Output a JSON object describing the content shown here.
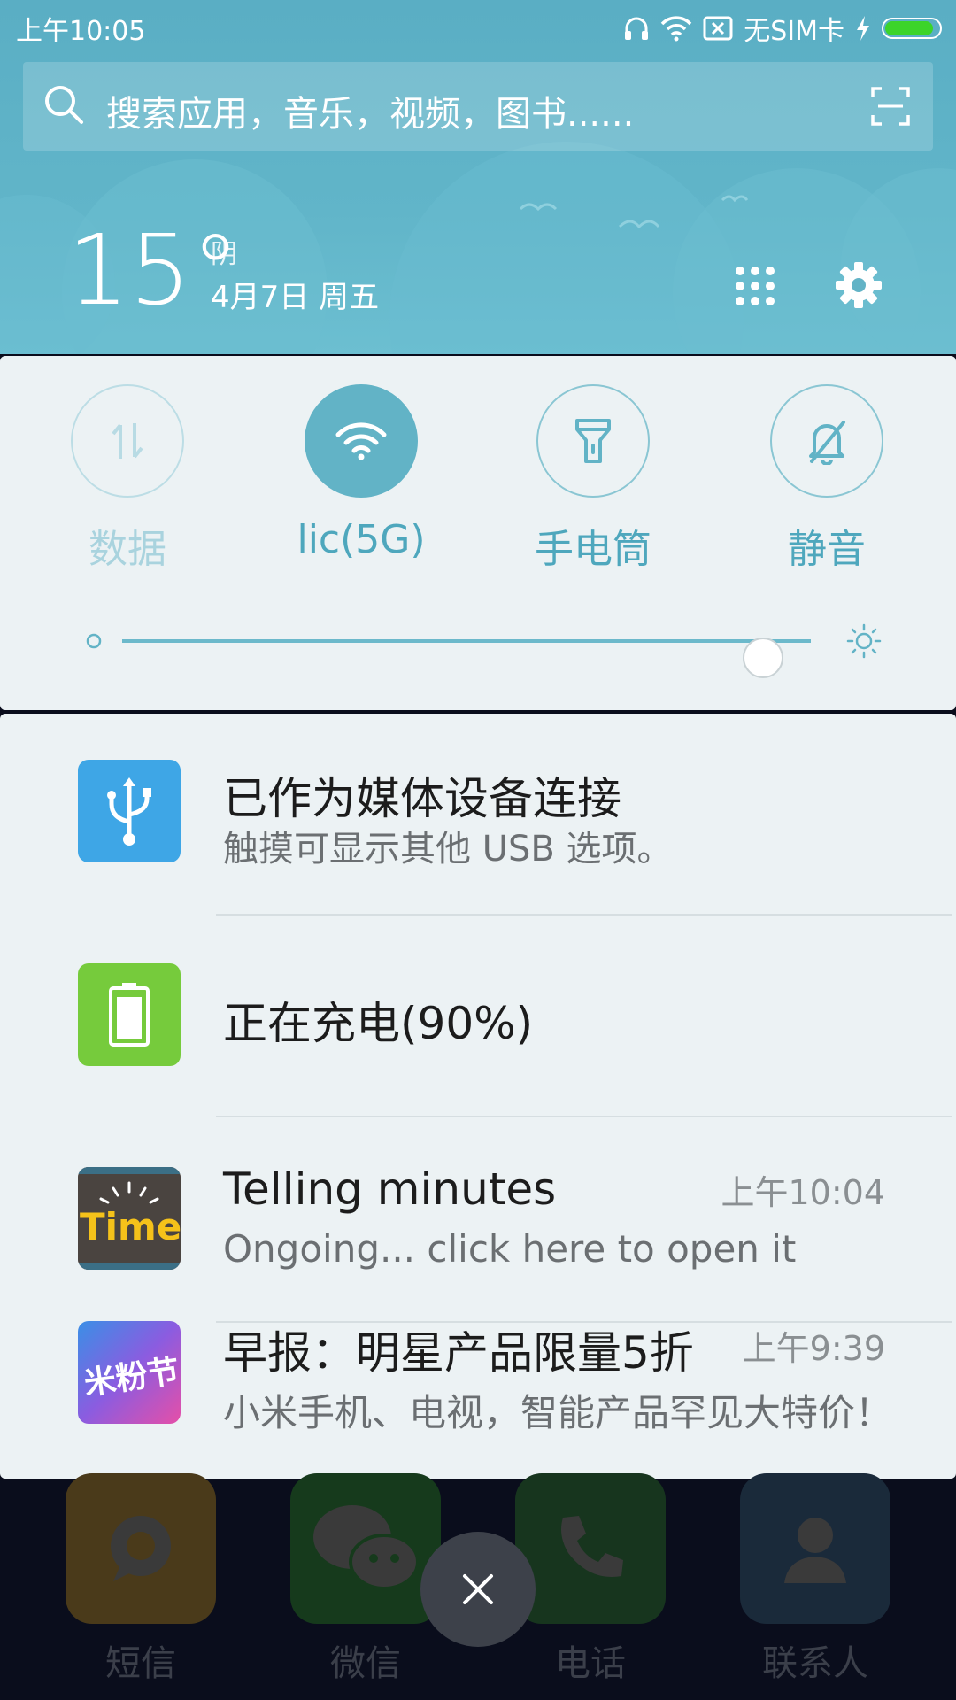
{
  "status_bar": {
    "time": "上午10:05",
    "sim_text": "无SIM卡",
    "battery_level": 0.9,
    "battery_color": "#3cd42a",
    "icons": [
      "headset-icon",
      "wifi-icon",
      "no-sim-icon",
      "charging-bolt-icon"
    ]
  },
  "search": {
    "placeholder": "搜索应用，音乐，视频，图书......"
  },
  "weather": {
    "temperature": "15°",
    "condition": "阴",
    "date": "4月7日 周五"
  },
  "quick_toggles": [
    {
      "label": "数据",
      "icon": "data-arrows-icon",
      "state": "off"
    },
    {
      "label": "lic(5G)",
      "icon": "wifi-icon",
      "state": "on"
    },
    {
      "label": "手电筒",
      "icon": "flashlight-icon",
      "state": "off"
    },
    {
      "label": "静音",
      "icon": "bell-mute-icon",
      "state": "off"
    }
  ],
  "brightness": {
    "level": 0.93
  },
  "notifications": [
    {
      "title": "已作为媒体设备连接",
      "subtitle": "触摸可显示其他 USB 选项。",
      "time": "",
      "icon": "usb-icon",
      "icon_color": "#3ea6e6"
    },
    {
      "title": "正在充电(90%)",
      "subtitle": "",
      "time": "",
      "icon": "battery-icon",
      "icon_color": "#76cb3c"
    },
    {
      "title": "Telling minutes",
      "subtitle": "Ongoing... click here to open it",
      "time": "上午10:04",
      "icon": "time-app-icon"
    },
    {
      "title": "早报：明星产品限量5折",
      "subtitle": "小米手机、电视，智能产品罕见大特价！",
      "time": "上午9:39",
      "icon": "mi-fan-festival-icon"
    }
  ],
  "dock": [
    {
      "label": "短信",
      "icon": "sms-icon",
      "color": "#4a3a1a"
    },
    {
      "label": "微信",
      "icon": "wechat-icon",
      "color": "#163a1c"
    },
    {
      "label": "电话",
      "icon": "phone-icon",
      "color": "#17351e"
    },
    {
      "label": "联系人",
      "icon": "contacts-icon",
      "color": "#1a2a3a"
    }
  ]
}
